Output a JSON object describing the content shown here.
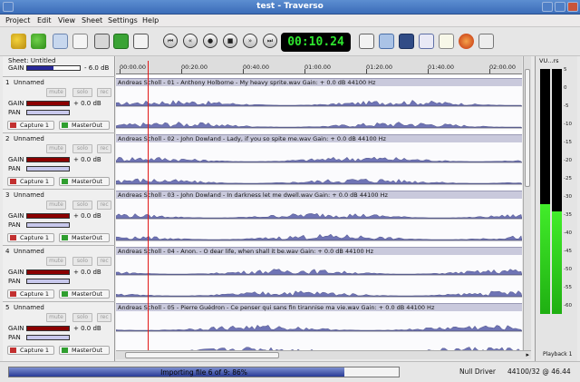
{
  "window": {
    "title": "test - Traverso"
  },
  "menu": [
    "Project",
    "Edit",
    "View",
    "Sheet",
    "Settings",
    "Help"
  ],
  "transport": {
    "time": "00:10.24"
  },
  "sheet": {
    "label": "Sheet: Untitled",
    "gain_label": "GAIN",
    "gain_value": "- 6.0 dB",
    "gain_level": 0.5
  },
  "track_common": {
    "mute": "mute",
    "solo": "solo",
    "rec": "rec",
    "gain": "GAIN",
    "pan": "PAN"
  },
  "tracks": [
    {
      "num": "1",
      "name": "Unnamed",
      "gain": "+ 0.0 dB",
      "in": "Capture 1",
      "out": "MasterOut",
      "clip": "Andreas Scholl - 01 - Anthony Holborne - My heavy sprite.wav   Gain: + 0.0 dB   44100 Hz"
    },
    {
      "num": "2",
      "name": "Unnamed",
      "gain": "+ 0.0 dB",
      "in": "Capture 1",
      "out": "MasterOut",
      "clip": "Andreas Scholl - 02 - John Dowland - Lady, if you so spite me.wav   Gain: + 0.0 dB   44100 Hz"
    },
    {
      "num": "3",
      "name": "Unnamed",
      "gain": "+ 0.0 dB",
      "in": "Capture 1",
      "out": "MasterOut",
      "clip": "Andreas Scholl - 03 - John Dowland - In darkness let me dwell.wav   Gain: + 0.0 dB   44100 Hz"
    },
    {
      "num": "4",
      "name": "Unnamed",
      "gain": "+ 0.0 dB",
      "in": "Capture 1",
      "out": "MasterOut",
      "clip": "Andreas Scholl - 04 - Anon. - O dear life, when shall it be.wav   Gain: + 0.0 dB   44100 Hz"
    },
    {
      "num": "5",
      "name": "Unnamed",
      "gain": "+ 0.0 dB",
      "in": "Capture 1",
      "out": "MasterOut",
      "clip": "Andreas Scholl - 05 - Pierre Guédron - Ce penser qui sans fin tirannise ma vie.wav   Gain: + 0.0 dB   44100 Hz"
    }
  ],
  "timeline": {
    "ticks": [
      "00:00.00",
      "00:20.00",
      "00:40.00",
      "01:00.00",
      "01:20.00",
      "01:40.00",
      "02:00.00"
    ]
  },
  "vu": {
    "title": "VU...rs",
    "label": "Playback 1",
    "scale": [
      "5",
      "0",
      "-5",
      "-10",
      "-15",
      "-20",
      "-25",
      "-30",
      "-35",
      "-40",
      "-45",
      "-50",
      "-55",
      "-60"
    ],
    "level_left": 0.45,
    "level_right": 0.42
  },
  "status": {
    "progress_text": "Importing file 6 of 9: 86%",
    "progress": 0.86,
    "driver": "Null Driver",
    "rate": "44100/32 @ 46.44"
  },
  "colors": {
    "accent": "#293b96",
    "gain_bar": "#8b0000",
    "wave": "#6f74b5",
    "playhead": "#e21818",
    "clock": "#2ee62e"
  }
}
